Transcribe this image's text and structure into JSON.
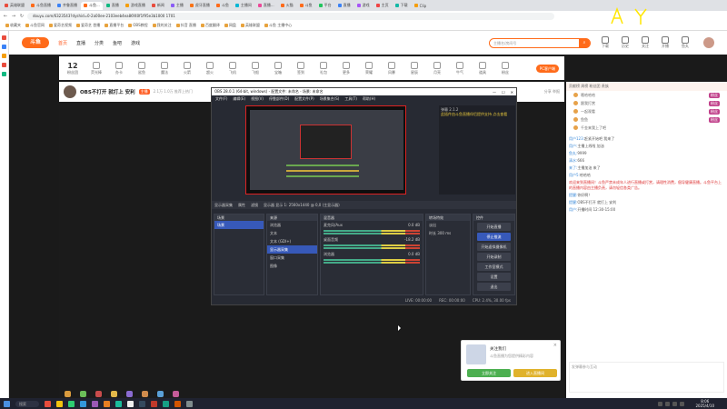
{
  "browser": {
    "tabs": [
      {
        "label": "英雄联盟"
      },
      {
        "label": "斗鱼直播"
      },
      {
        "label": "齐鲁直播"
      },
      {
        "label": "斗鱼..."
      },
      {
        "label": "直播"
      },
      {
        "label": "游戏直播"
      },
      {
        "label": "新闻"
      },
      {
        "label": "主播"
      },
      {
        "label": "虎牙直播"
      },
      {
        "label": "斗鱼"
      },
      {
        "label": "主播间"
      },
      {
        "label": "直播..."
      },
      {
        "label": "火猫"
      },
      {
        "label": "斗鱼"
      },
      {
        "label": "平台"
      },
      {
        "label": "直播"
      },
      {
        "label": "游戏"
      },
      {
        "label": "主页"
      },
      {
        "label": "下载"
      },
      {
        "label": "Clip"
      }
    ],
    "url": "douyu.com/6323543?dyshid=0-2a00ee-2103eeb4ea86f40f1f95e3b1000 1701",
    "bookmarks": [
      "收藏夹",
      "斗鱼官网",
      "爱奇艺视频",
      "爱奇艺 首播",
      "直播平台",
      "OBS教程",
      "我的关注",
      "抖音 直播",
      "百度翻译",
      "网盘",
      "英雄联盟",
      "斗鱼 主播中心"
    ]
  },
  "site": {
    "logo": "斗鱼",
    "nav": [
      "首页",
      "直播",
      "分类",
      "鱼吧",
      "游戏"
    ],
    "search_placeholder": "主播名/房间号",
    "search_btn": "⌕",
    "header_icons": [
      "下载",
      "历史",
      "关注",
      "开播",
      "鱼丸"
    ]
  },
  "giftbar": {
    "fans_count": "12",
    "fans_label": "粉丝团",
    "gifts": [
      "荧光棒",
      "办卡",
      "鲨鱼",
      "魔法",
      "火箭",
      "超火",
      "飞机",
      "飞船",
      "宝箱",
      "签到",
      "礼包",
      "更多",
      "荣耀",
      "风暴",
      "星辰",
      "月亮",
      "牛气",
      "道具",
      "粉丝"
    ],
    "pc_button": "PC客户端"
  },
  "room": {
    "title": "OBS不打开 就打上 安利",
    "tag": "主播",
    "meta": "2.1万  1.0万  推荐上热门",
    "right": "分享 举报"
  },
  "obs": {
    "title": "OBS 28.0.1 (64-bit, windows) - 配置文件: 未命名 - 场景: 未命名",
    "menu": [
      "文件(F)",
      "编辑(E)",
      "视图(V)",
      "停靠部件(D)",
      "配置文件(P)",
      "场景集合(S)",
      "工具(T)",
      "帮助(H)"
    ],
    "side_panel": {
      "header": "弹幕 2.1.2",
      "line1": "此插件由斗鱼直播伴侣提供支持 点击查看",
      "line2": ""
    },
    "control_bar": [
      "显示器采集",
      "属性",
      "滤镜",
      "显示器 显示 1: 2560x1440 @ 0,0 (主显示器)"
    ],
    "docks": {
      "scenes": {
        "title": "场景",
        "items": [
          "场景"
        ]
      },
      "sources": {
        "title": "来源",
        "items": [
          "浏览器",
          "文本",
          "文本 (GDI+)",
          "显示器采集",
          "窗口采集",
          "图像"
        ]
      },
      "mixer": {
        "title": "混音器",
        "items": [
          "麦克风/Aux",
          "桌面音频",
          "浏览器"
        ],
        "db": [
          "0.0 dB",
          "-18.2 dB",
          "0.0 dB"
        ]
      },
      "transitions": {
        "title": "转场特效",
        "mode": "淡出",
        "duration_label": "时长",
        "duration": "300 ms"
      },
      "controls": {
        "title": "控件",
        "buttons": [
          "开始直播",
          "停止推流",
          "开始虚拟摄像机",
          "工作室模式",
          "设置",
          "退出"
        ],
        "recording": "开始录制"
      }
    },
    "status": [
      "LIVE: 00:00:00",
      "REC: 00:00:00",
      "CPU: 2.4%, 30.00 fps"
    ]
  },
  "chat": {
    "header": "贡献榜  周榜  粉丝团  贵族",
    "ranks": [
      {
        "name": "哦哈哈哈",
        "tag": "粉丝"
      },
      {
        "name": "跟我打赏",
        "tag": "粉丝"
      },
      {
        "name": "一起观看",
        "tag": "粉丝"
      },
      {
        "name": "鱼鱼",
        "tag": "粉丝"
      },
      {
        "name": "千金来我上了吧",
        "tag": ""
      }
    ],
    "messages": [
      {
        "user": "用户123:",
        "text": "赶紧开始吧 我来了"
      },
      {
        "user": "用户:",
        "text": "主播上线啦 加油"
      },
      {
        "user": "鱼丸:",
        "text": "9999"
      },
      {
        "user": "清水:",
        "text": "666"
      },
      {
        "user": "来了:",
        "text": "主播加油 来了"
      },
      {
        "user": "用户5:",
        "text": "哈哈哈"
      },
      {
        "user": "",
        "text": "欢迎来到直播间！斗鱼严禁未成年人进行直播或打赏，请理性消费，倡导健康直播。斗鱼平台上的直播内容由主播负责，请勿轻信各类广告。"
      },
      {
        "user": "提醒:",
        "text": "你好啊！"
      },
      {
        "user": "提醒:",
        "text": "OBS不打开 就打上 安利"
      },
      {
        "user": "用户:",
        "text": "开播时间 12:30-15:00"
      }
    ],
    "input_placeholder": "发弹幕参与互动"
  },
  "popup": {
    "title": "关注我们",
    "subtitle": "斗鱼直播为您提供精彩内容",
    "close": "×",
    "btn1": "立即关注",
    "btn2": "进入直播间"
  },
  "taskbar": {
    "search": "搜索",
    "time": "8:06",
    "date": "2025/4/10"
  }
}
